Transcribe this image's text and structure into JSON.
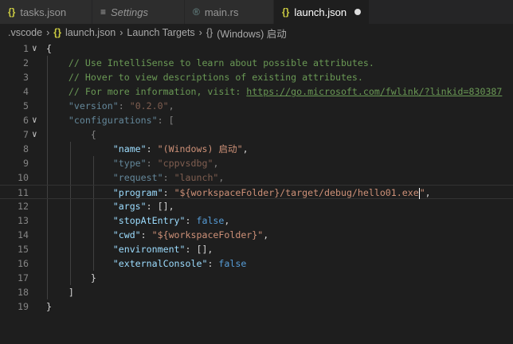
{
  "tabs": [
    {
      "label": "tasks.json",
      "icon": "json-icon",
      "glyph": "{}"
    },
    {
      "label": "Settings",
      "icon": "settings-icon",
      "glyph": "≡"
    },
    {
      "label": "main.rs",
      "icon": "rust-icon",
      "glyph": "®"
    },
    {
      "label": "launch.json",
      "icon": "json-icon",
      "glyph": "{}",
      "active": true,
      "modified": true
    }
  ],
  "breadcrumb": [
    ".vscode",
    "launch.json",
    "Launch Targets",
    "(Windows) 启动"
  ],
  "breadcrumb_glyph": "{}",
  "lines": [
    {
      "n": "1",
      "fold": true,
      "dim": false,
      "t": [
        [
          "p",
          "{"
        ]
      ]
    },
    {
      "n": "2",
      "t": [
        [
          "p",
          "    "
        ],
        [
          "cm",
          "// Use IntelliSense to learn about possible attributes."
        ]
      ]
    },
    {
      "n": "3",
      "t": [
        [
          "p",
          "    "
        ],
        [
          "cm",
          "// Hover to view descriptions of existing attributes."
        ]
      ]
    },
    {
      "n": "4",
      "t": [
        [
          "p",
          "    "
        ],
        [
          "cm",
          "// For more information, visit: "
        ],
        [
          "lk",
          "https://go.microsoft.com/fwlink/?linkid=830387"
        ]
      ]
    },
    {
      "n": "5",
      "dim": true,
      "t": [
        [
          "p",
          "    "
        ],
        [
          "k",
          "\"version\""
        ],
        [
          "p",
          ": "
        ],
        [
          "s",
          "\"0.2.0\""
        ],
        [
          "p",
          ","
        ]
      ]
    },
    {
      "n": "6",
      "fold": true,
      "dim": true,
      "t": [
        [
          "p",
          "    "
        ],
        [
          "k",
          "\"configurations\""
        ],
        [
          "p",
          ": ["
        ]
      ]
    },
    {
      "n": "7",
      "fold": true,
      "dim": true,
      "t": [
        [
          "p",
          "        {"
        ]
      ]
    },
    {
      "n": "8",
      "t": [
        [
          "p",
          "            "
        ],
        [
          "k",
          "\"name\""
        ],
        [
          "p",
          ": "
        ],
        [
          "s",
          "\"(Windows) 启动\""
        ],
        [
          "p",
          ","
        ]
      ]
    },
    {
      "n": "9",
      "dim": true,
      "t": [
        [
          "p",
          "            "
        ],
        [
          "k",
          "\"type\""
        ],
        [
          "p",
          ": "
        ],
        [
          "s",
          "\"cppvsdbg\""
        ],
        [
          "p",
          ","
        ]
      ]
    },
    {
      "n": "10",
      "dim": true,
      "t": [
        [
          "p",
          "            "
        ],
        [
          "k",
          "\"request\""
        ],
        [
          "p",
          ": "
        ],
        [
          "s",
          "\"launch\""
        ],
        [
          "p",
          ","
        ]
      ]
    },
    {
      "n": "11",
      "current": true,
      "t": [
        [
          "p",
          "            "
        ],
        [
          "k",
          "\"program\""
        ],
        [
          "p",
          ": "
        ],
        [
          "s",
          "\"${workspaceFolder}/target/debug/hello01.exe"
        ],
        [
          "caret",
          ""
        ],
        [
          "s",
          "\""
        ],
        [
          "p",
          ","
        ]
      ]
    },
    {
      "n": "12",
      "t": [
        [
          "p",
          "            "
        ],
        [
          "k",
          "\"args\""
        ],
        [
          "p",
          ": [],"
        ]
      ]
    },
    {
      "n": "13",
      "t": [
        [
          "p",
          "            "
        ],
        [
          "k",
          "\"stopAtEntry\""
        ],
        [
          "p",
          ": "
        ],
        [
          "b",
          "false"
        ],
        [
          "p",
          ","
        ]
      ]
    },
    {
      "n": "14",
      "t": [
        [
          "p",
          "            "
        ],
        [
          "k",
          "\"cwd\""
        ],
        [
          "p",
          ": "
        ],
        [
          "s",
          "\"${workspaceFolder}\""
        ],
        [
          "p",
          ","
        ]
      ]
    },
    {
      "n": "15",
      "t": [
        [
          "p",
          "            "
        ],
        [
          "k",
          "\"environment\""
        ],
        [
          "p",
          ": [],"
        ]
      ]
    },
    {
      "n": "16",
      "t": [
        [
          "p",
          "            "
        ],
        [
          "k",
          "\"externalConsole\""
        ],
        [
          "p",
          ": "
        ],
        [
          "b",
          "false"
        ]
      ]
    },
    {
      "n": "17",
      "t": [
        [
          "p",
          "        }"
        ]
      ]
    },
    {
      "n": "18",
      "t": [
        [
          "p",
          "    ]"
        ]
      ]
    },
    {
      "n": "19",
      "t": [
        [
          "p",
          "}"
        ]
      ]
    }
  ]
}
